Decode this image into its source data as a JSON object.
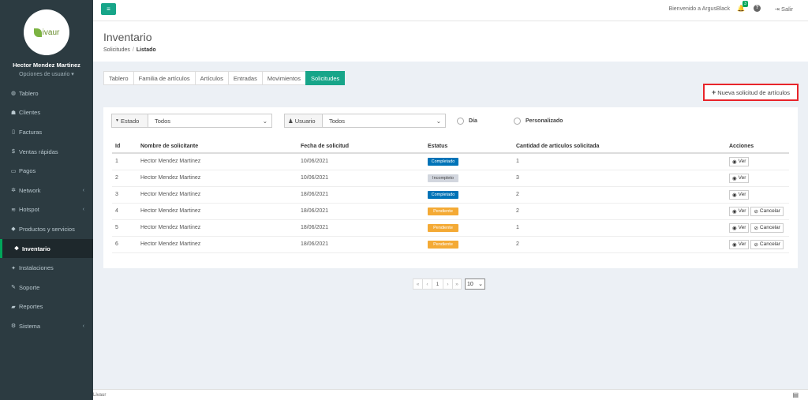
{
  "brand": {
    "logo_text": "ivaur"
  },
  "user": {
    "name": "Hector Mendez Martinez",
    "options": "Opciones de usuario ▾"
  },
  "sidebar": {
    "items": [
      {
        "label": "Tablero",
        "icon": "dashboard-icon",
        "glyph": "◍"
      },
      {
        "label": "Clientes",
        "icon": "users-icon",
        "glyph": "☗"
      },
      {
        "label": "Facturas",
        "icon": "file-icon",
        "glyph": "▯"
      },
      {
        "label": "Ventas rápidas",
        "icon": "dollar-icon",
        "glyph": "$"
      },
      {
        "label": "Pagos",
        "icon": "money-icon",
        "glyph": "▭"
      },
      {
        "label": "Network",
        "icon": "network-icon",
        "glyph": "✲"
      },
      {
        "label": "Hotspot",
        "icon": "wifi-icon",
        "glyph": "≋"
      },
      {
        "label": "Productos y servicios",
        "icon": "tag-icon",
        "glyph": "◆"
      },
      {
        "label": "Inventario",
        "icon": "cubes-icon",
        "glyph": "❖"
      },
      {
        "label": "Instalaciones",
        "icon": "tools-icon",
        "glyph": "✦"
      },
      {
        "label": "Soporte",
        "icon": "wrench-icon",
        "glyph": "✎"
      },
      {
        "label": "Reportes",
        "icon": "book-icon",
        "glyph": "▰"
      },
      {
        "label": "Sistema",
        "icon": "cogs-icon",
        "glyph": "⚙"
      }
    ],
    "chevron": "‹"
  },
  "topbar": {
    "toggle": "≡",
    "welcome": "Bienvenido a ArgusBlack",
    "bell": "🔔",
    "notif_count": "3",
    "help": "?",
    "logout": "⇥  Salir"
  },
  "header": {
    "title": "Inventario",
    "crumb1": "Solicitudes",
    "crumb_sep": "/",
    "crumb2": "Listado"
  },
  "tabs": [
    "Tablero",
    "Familia de artículos",
    "Artículos",
    "Entradas",
    "Movimientos",
    "Solicitudes"
  ],
  "new_button": {
    "plus": "+",
    "label": "Nueva solicitud de artículos"
  },
  "filters": {
    "estado_label": "Estado",
    "estado_icon": "▼",
    "estado_value": "Todos",
    "usuario_label": "Usuario",
    "usuario_icon": "♟",
    "usuario_value": "Todos",
    "caret": "⌄",
    "radio1": "Día",
    "radio2": "Personalizado"
  },
  "table": {
    "headers": [
      "Id",
      "Nombre de solicitante",
      "Fecha de solicitud",
      "Estatus",
      "Cantidad de articulos solicitada",
      "Acciones"
    ],
    "rows": [
      {
        "id": "1",
        "name": "Hector Mendez Martinez",
        "date": "10/06/2021",
        "status": "Completado",
        "qty": "1"
      },
      {
        "id": "2",
        "name": "Hector Mendez Martinez",
        "date": "10/06/2021",
        "status": "Incompleto",
        "qty": "3"
      },
      {
        "id": "3",
        "name": "Hector Mendez Martinez",
        "date": "18/06/2021",
        "status": "Completado",
        "qty": "2"
      },
      {
        "id": "4",
        "name": "Hector Mendez Martinez",
        "date": "18/06/2021",
        "status": "Pendiente",
        "qty": "2"
      },
      {
        "id": "5",
        "name": "Hector Mendez Martinez",
        "date": "18/06/2021",
        "status": "Pendiente",
        "qty": "1"
      },
      {
        "id": "6",
        "name": "Hector Mendez Martinez",
        "date": "18/06/2021",
        "status": "Pendiente",
        "qty": "2"
      }
    ],
    "ver_label": "Ver",
    "ver_icon": "◉",
    "cancel_label": "Cancelar",
    "cancel_icon": "⊘"
  },
  "pagination": {
    "first": "«",
    "prev": "‹",
    "page": "1",
    "next": "›",
    "last": "»",
    "per_page": "10"
  },
  "footer": {
    "text": "Livaur",
    "icon": "▤"
  },
  "colors": {
    "accent": "#17a589",
    "sidebar_bg": "#2c3b41",
    "highlight": "#e8242a"
  }
}
